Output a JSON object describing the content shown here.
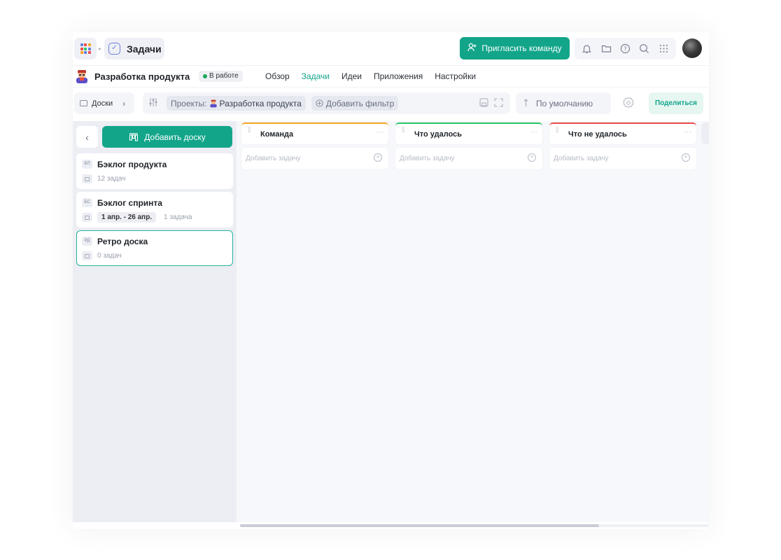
{
  "app": {
    "module_title": "Задачи",
    "invite_button": "Пригласить команду",
    "colors": {
      "accent": "#12a58a",
      "orange": "#f5a524",
      "green": "#2ac769",
      "red": "#ea4b4b",
      "status_green": "#1aa85c"
    },
    "tools": [
      "bell-icon",
      "folder-icon",
      "help-icon",
      "search-icon",
      "grid-icon"
    ]
  },
  "project": {
    "name": "Разработка продукта",
    "status": "В работе",
    "tabs": [
      {
        "label": "Обзор",
        "active": false
      },
      {
        "label": "Задачи",
        "active": true
      },
      {
        "label": "Идеи",
        "active": false
      },
      {
        "label": "Приложения",
        "active": false
      },
      {
        "label": "Настройки",
        "active": false
      }
    ]
  },
  "toolbar": {
    "boards_label": "Доски",
    "filter_projects_label": "Проекты:",
    "filter_project_value": "Разработка продукта",
    "add_filter_label": "Добавить фильтр",
    "sort_label": "По умолчанию",
    "share_label": "Поделиться"
  },
  "sidebar": {
    "add_board_label": "Добавить доску",
    "boards": [
      {
        "abbr": "БП",
        "name": "Бэклог продукта",
        "meta": "12 задач",
        "selected": false
      },
      {
        "abbr": "БС",
        "name": "Бэклог спринта",
        "date": "1 апр. - 26 апр.",
        "meta": "1 задача",
        "selected": false
      },
      {
        "abbr": "РД",
        "name": "Ретро доска",
        "meta": "0 задач",
        "selected": true
      }
    ]
  },
  "columns": [
    {
      "title": "Команда",
      "color": "#f5a524",
      "add_task": "Добавить задачу"
    },
    {
      "title": "Что удалось",
      "color": "#2ac769",
      "add_task": "Добавить задачу"
    },
    {
      "title": "Что не удалось",
      "color": "#ea4b4b",
      "add_task": "Добавить задачу"
    }
  ]
}
